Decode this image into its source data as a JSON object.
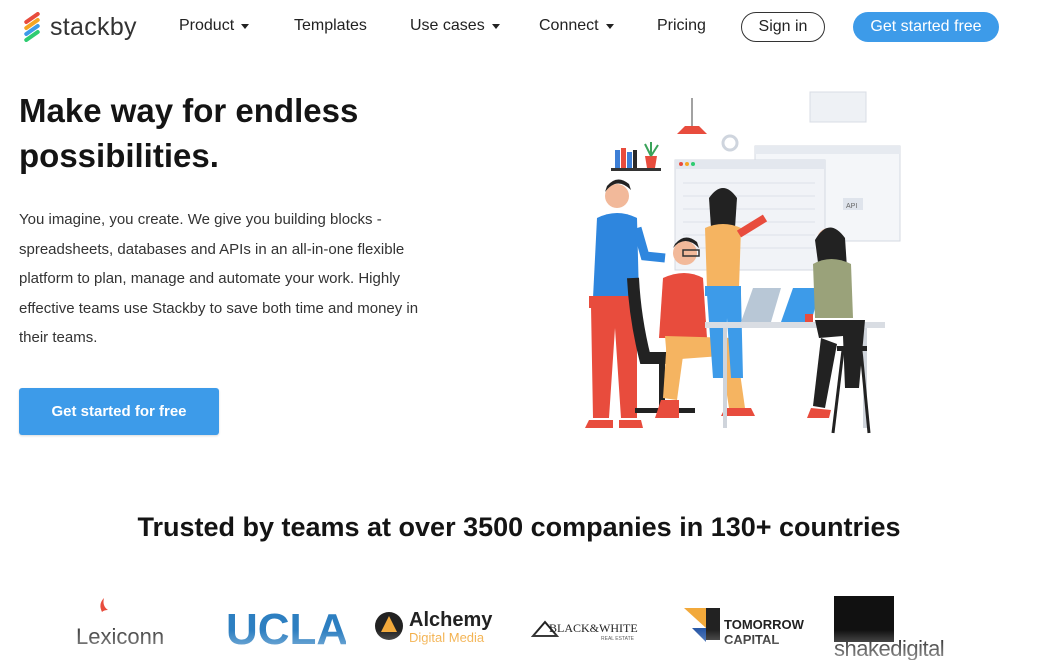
{
  "brand": {
    "name": "stackby"
  },
  "nav": {
    "items": [
      {
        "label": "Product",
        "dropdown": true
      },
      {
        "label": "Templates",
        "dropdown": false
      },
      {
        "label": "Use cases",
        "dropdown": true
      },
      {
        "label": "Connect",
        "dropdown": true
      },
      {
        "label": "Pricing",
        "dropdown": false
      }
    ],
    "signin_label": "Sign in",
    "cta_label": "Get started free"
  },
  "hero": {
    "title_line1": "Make way for endless",
    "title_line2": "possibilities.",
    "description": "You imagine, you create. We give you building blocks - spreadsheets, databases and APIs in an all-in-one flexible platform to plan, manage and automate your work. Highly effective teams use Stackby to save both time and money in their teams.",
    "cta_label": "Get started for free",
    "illustration_api_label": "API"
  },
  "trusted": {
    "heading": "Trusted by teams at over 3500 companies in 130+ countries",
    "logos": {
      "lexiconn": "Lexiconn",
      "ucla": "UCLA",
      "alchemy_title": "Alchemy",
      "alchemy_sub": "Digital Media",
      "bw_title": "BLACK&WHITE",
      "bw_sub": "REAL ESTATE",
      "tomorrow_line1": "TOMORROW",
      "tomorrow_line2": "CAPITAL",
      "shake_a": "shake",
      "shake_b": "digital"
    }
  },
  "colors": {
    "primary": "#3d9be9",
    "text": "#141414",
    "ucla_blue": "#2d7fc1",
    "alchemy_orange": "#f2a93b"
  }
}
